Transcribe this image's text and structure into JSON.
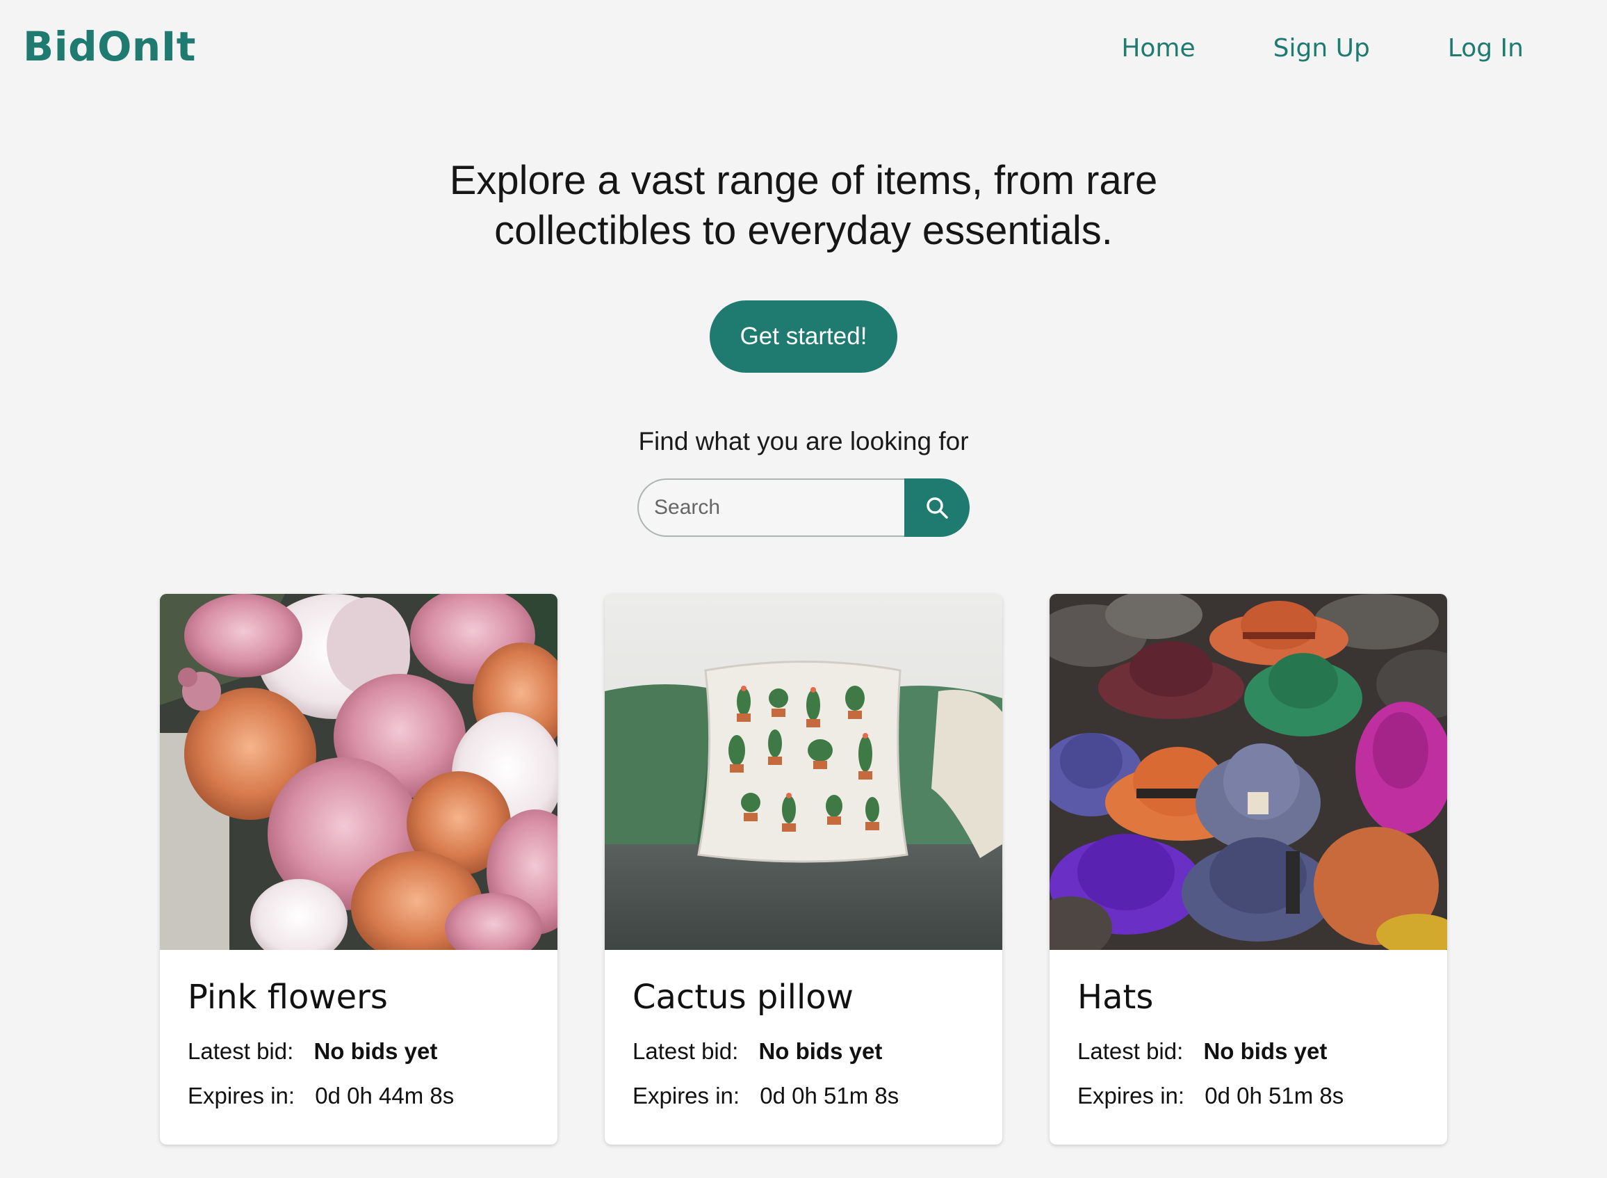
{
  "brand": {
    "name": "BidOnIt",
    "color": "#1f7a70"
  },
  "nav": {
    "items": [
      "Home",
      "Sign Up",
      "Log In"
    ]
  },
  "hero": {
    "title_line1": "Explore a vast range of items, from rare",
    "title_line2": "collectibles to everyday essentials.",
    "cta_label": "Get started!"
  },
  "search": {
    "label": "Find what you are looking for",
    "placeholder": "Search",
    "icon": "search-icon"
  },
  "listings": [
    {
      "title": "Pink flowers",
      "latest_bid_label": "Latest bid:",
      "latest_bid": "No bids yet",
      "expires_label": "Expires in:",
      "expires": "0d 0h 44m 8s",
      "image": "flowers-photo"
    },
    {
      "title": "Cactus pillow",
      "latest_bid_label": "Latest bid:",
      "latest_bid": "No bids yet",
      "expires_label": "Expires in:",
      "expires": "0d 0h 51m 8s",
      "image": "cactus-pillow-photo"
    },
    {
      "title": "Hats",
      "latest_bid_label": "Latest bid:",
      "latest_bid": "No bids yet",
      "expires_label": "Expires in:",
      "expires": "0d 0h 51m 8s",
      "image": "hats-photo"
    }
  ]
}
